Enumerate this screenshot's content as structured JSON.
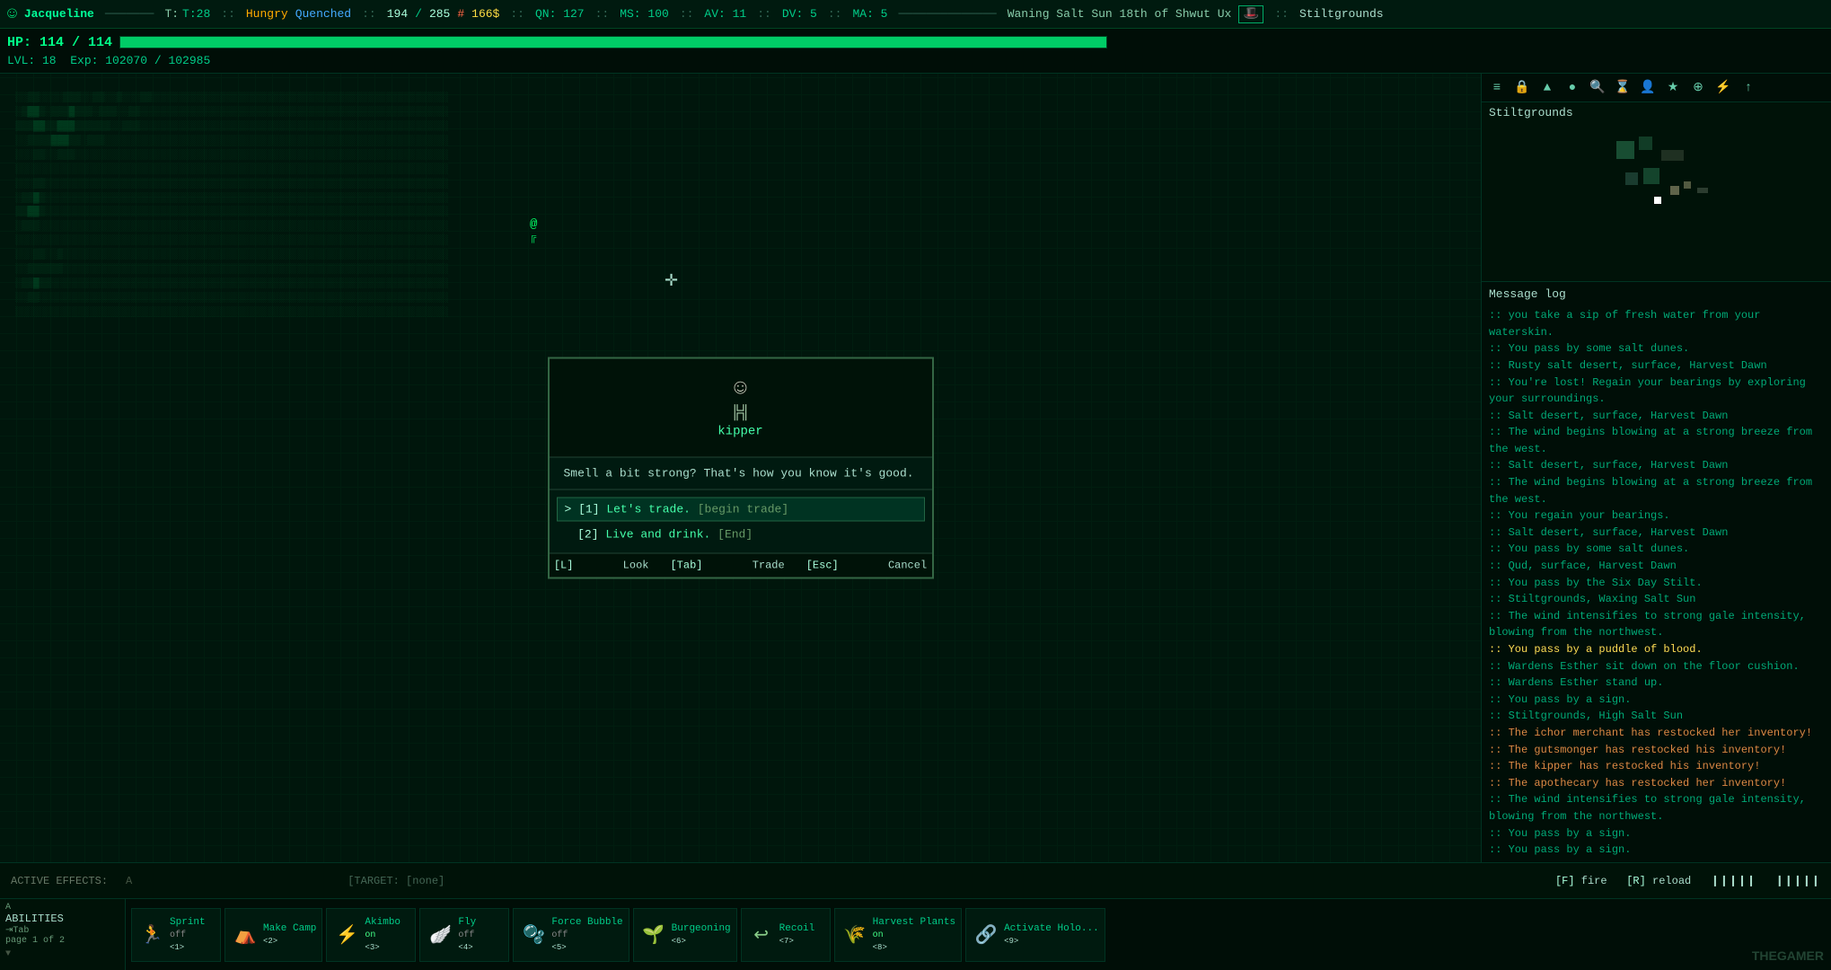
{
  "topbar": {
    "icon": "☺",
    "name": "Jacqueline",
    "time": "T:28",
    "hungry": "Hungry",
    "quench": "Quenched",
    "hp_cur": "194",
    "hp_max": "285",
    "hp_sign": "#",
    "gold": "166$",
    "qn": "QN: 127",
    "ms": "MS: 100",
    "av": "AV: 11",
    "dv": "DV: 5",
    "ma": "MA: 5",
    "date": "Waning Salt Sun 18th of Shwut Ux",
    "location": "Stiltgrounds"
  },
  "hpbar": {
    "label": "HP:",
    "cur": "114",
    "max": "114",
    "pct": 100,
    "lvl": "LVL: 18",
    "exp_cur": "102070",
    "exp_max": "102985"
  },
  "minimap": {
    "title": "Stiltgrounds"
  },
  "toolbar": {
    "icons": [
      "≡",
      "🔒",
      "▲",
      "●",
      "🔍",
      "⌛",
      "👤",
      "★",
      "⊕",
      "⚡",
      "↑"
    ]
  },
  "dialog": {
    "npc_name": "kipper",
    "greeting": "Smell a bit strong? That's how you know it's good.",
    "options": [
      {
        "num": "1",
        "text": "Let's trade.",
        "action": "[begin trade]",
        "selected": true
      },
      {
        "num": "2",
        "text": "Live and drink.",
        "action": "[End]",
        "selected": false
      }
    ],
    "footer": [
      {
        "key": "[L]",
        "label": "Look"
      },
      {
        "key": "[Tab]",
        "label": "Trade"
      },
      {
        "key": "[Esc]",
        "label": "Cancel"
      }
    ]
  },
  "messagelog": {
    "title": "Message log",
    "messages": [
      {
        "text": ":: you take a sip of fresh water from your waterskin.",
        "type": "normal"
      },
      {
        "text": ":: You pass by some salt dunes.",
        "type": "normal"
      },
      {
        "text": ":: Rusty salt desert, surface, Harvest Dawn",
        "type": "normal"
      },
      {
        "text": ":: You're lost! Regain your bearings by exploring your surroundings.",
        "type": "normal"
      },
      {
        "text": ":: Salt desert, surface, Harvest Dawn",
        "type": "normal"
      },
      {
        "text": ":: The wind begins blowing at a strong breeze from the west.",
        "type": "normal"
      },
      {
        "text": ":: Salt desert, surface, Harvest Dawn",
        "type": "normal"
      },
      {
        "text": ":: The wind begins blowing at a strong breeze from the west.",
        "type": "normal"
      },
      {
        "text": ":: You regain your bearings.",
        "type": "normal"
      },
      {
        "text": ":: Salt desert, surface, Harvest Dawn",
        "type": "normal"
      },
      {
        "text": ":: You pass by some salt dunes.",
        "type": "normal"
      },
      {
        "text": ":: Qud, surface, Harvest Dawn",
        "type": "normal"
      },
      {
        "text": ":: You pass by the Six Day Stilt.",
        "type": "normal"
      },
      {
        "text": ":: Stiltgrounds, Waxing Salt Sun",
        "type": "normal"
      },
      {
        "text": ":: The wind intensifies to strong gale intensity, blowing from the northwest.",
        "type": "normal"
      },
      {
        "text": ":: You pass by a puddle of blood.",
        "type": "highlight"
      },
      {
        "text": ":: Wardens Esther sit down on the floor cushion.",
        "type": "normal"
      },
      {
        "text": ":: Wardens Esther stand up.",
        "type": "normal"
      },
      {
        "text": ":: You pass by a sign.",
        "type": "normal"
      },
      {
        "text": ":: Stiltgrounds, High Salt Sun",
        "type": "normal"
      },
      {
        "text": ":: The ichor merchant has restocked her inventory!",
        "type": "merchant"
      },
      {
        "text": ":: The gutsmonger has restocked his inventory!",
        "type": "merchant"
      },
      {
        "text": ":: The kipper has restocked his inventory!",
        "type": "merchant"
      },
      {
        "text": ":: The apothecary has restocked her inventory!",
        "type": "merchant"
      },
      {
        "text": ":: The wind intensifies to strong gale intensity, blowing from the northwest.",
        "type": "normal"
      },
      {
        "text": ":: You pass by a sign.",
        "type": "normal"
      },
      {
        "text": ":: You pass by a sign.",
        "type": "normal"
      }
    ]
  },
  "bottomstatus": {
    "active_effects_label": "ACTIVE EFFECTS:",
    "active_effects_val": "",
    "targets_label": "TARGET:",
    "targets_val": "[none]",
    "fire_key": "[F]",
    "fire_label": "fire",
    "reload_key": "[R]",
    "reload_label": "reload"
  },
  "abilities": {
    "sidebar_title": "ABILITIES",
    "sidebar_sub": "⇥Tab",
    "sidebar_page": "page 1 of 2",
    "items": [
      {
        "icon": "🏃",
        "name": "Sprint",
        "status": "off",
        "key": "<1>",
        "status_type": "off"
      },
      {
        "icon": "⛺",
        "name": "Make Camp",
        "status": "",
        "key": "<2>",
        "status_type": "neutral"
      },
      {
        "icon": "⚡",
        "name": "Akimbo",
        "status": "on",
        "key": "<3>",
        "status_type": "on"
      },
      {
        "icon": "🪽",
        "name": "Fly",
        "status": "off",
        "key": "<4>",
        "status_type": "off"
      },
      {
        "icon": "🫧",
        "name": "Force Bubble",
        "status": "off",
        "key": "<5>",
        "status_type": "off"
      },
      {
        "icon": "🌱",
        "name": "Burgeoning",
        "status": "",
        "key": "<6>",
        "status_type": "neutral"
      },
      {
        "icon": "↩",
        "name": "Recoil",
        "status": "",
        "key": "<7>",
        "status_type": "neutral"
      },
      {
        "icon": "🌾",
        "name": "Harvest Plants",
        "status": "on",
        "key": "<8>",
        "status_type": "on"
      },
      {
        "icon": "🔗",
        "name": "Activate Holo...",
        "status": "",
        "key": "<9>",
        "status_type": "neutral"
      }
    ]
  },
  "watermark": "THEGAMER"
}
